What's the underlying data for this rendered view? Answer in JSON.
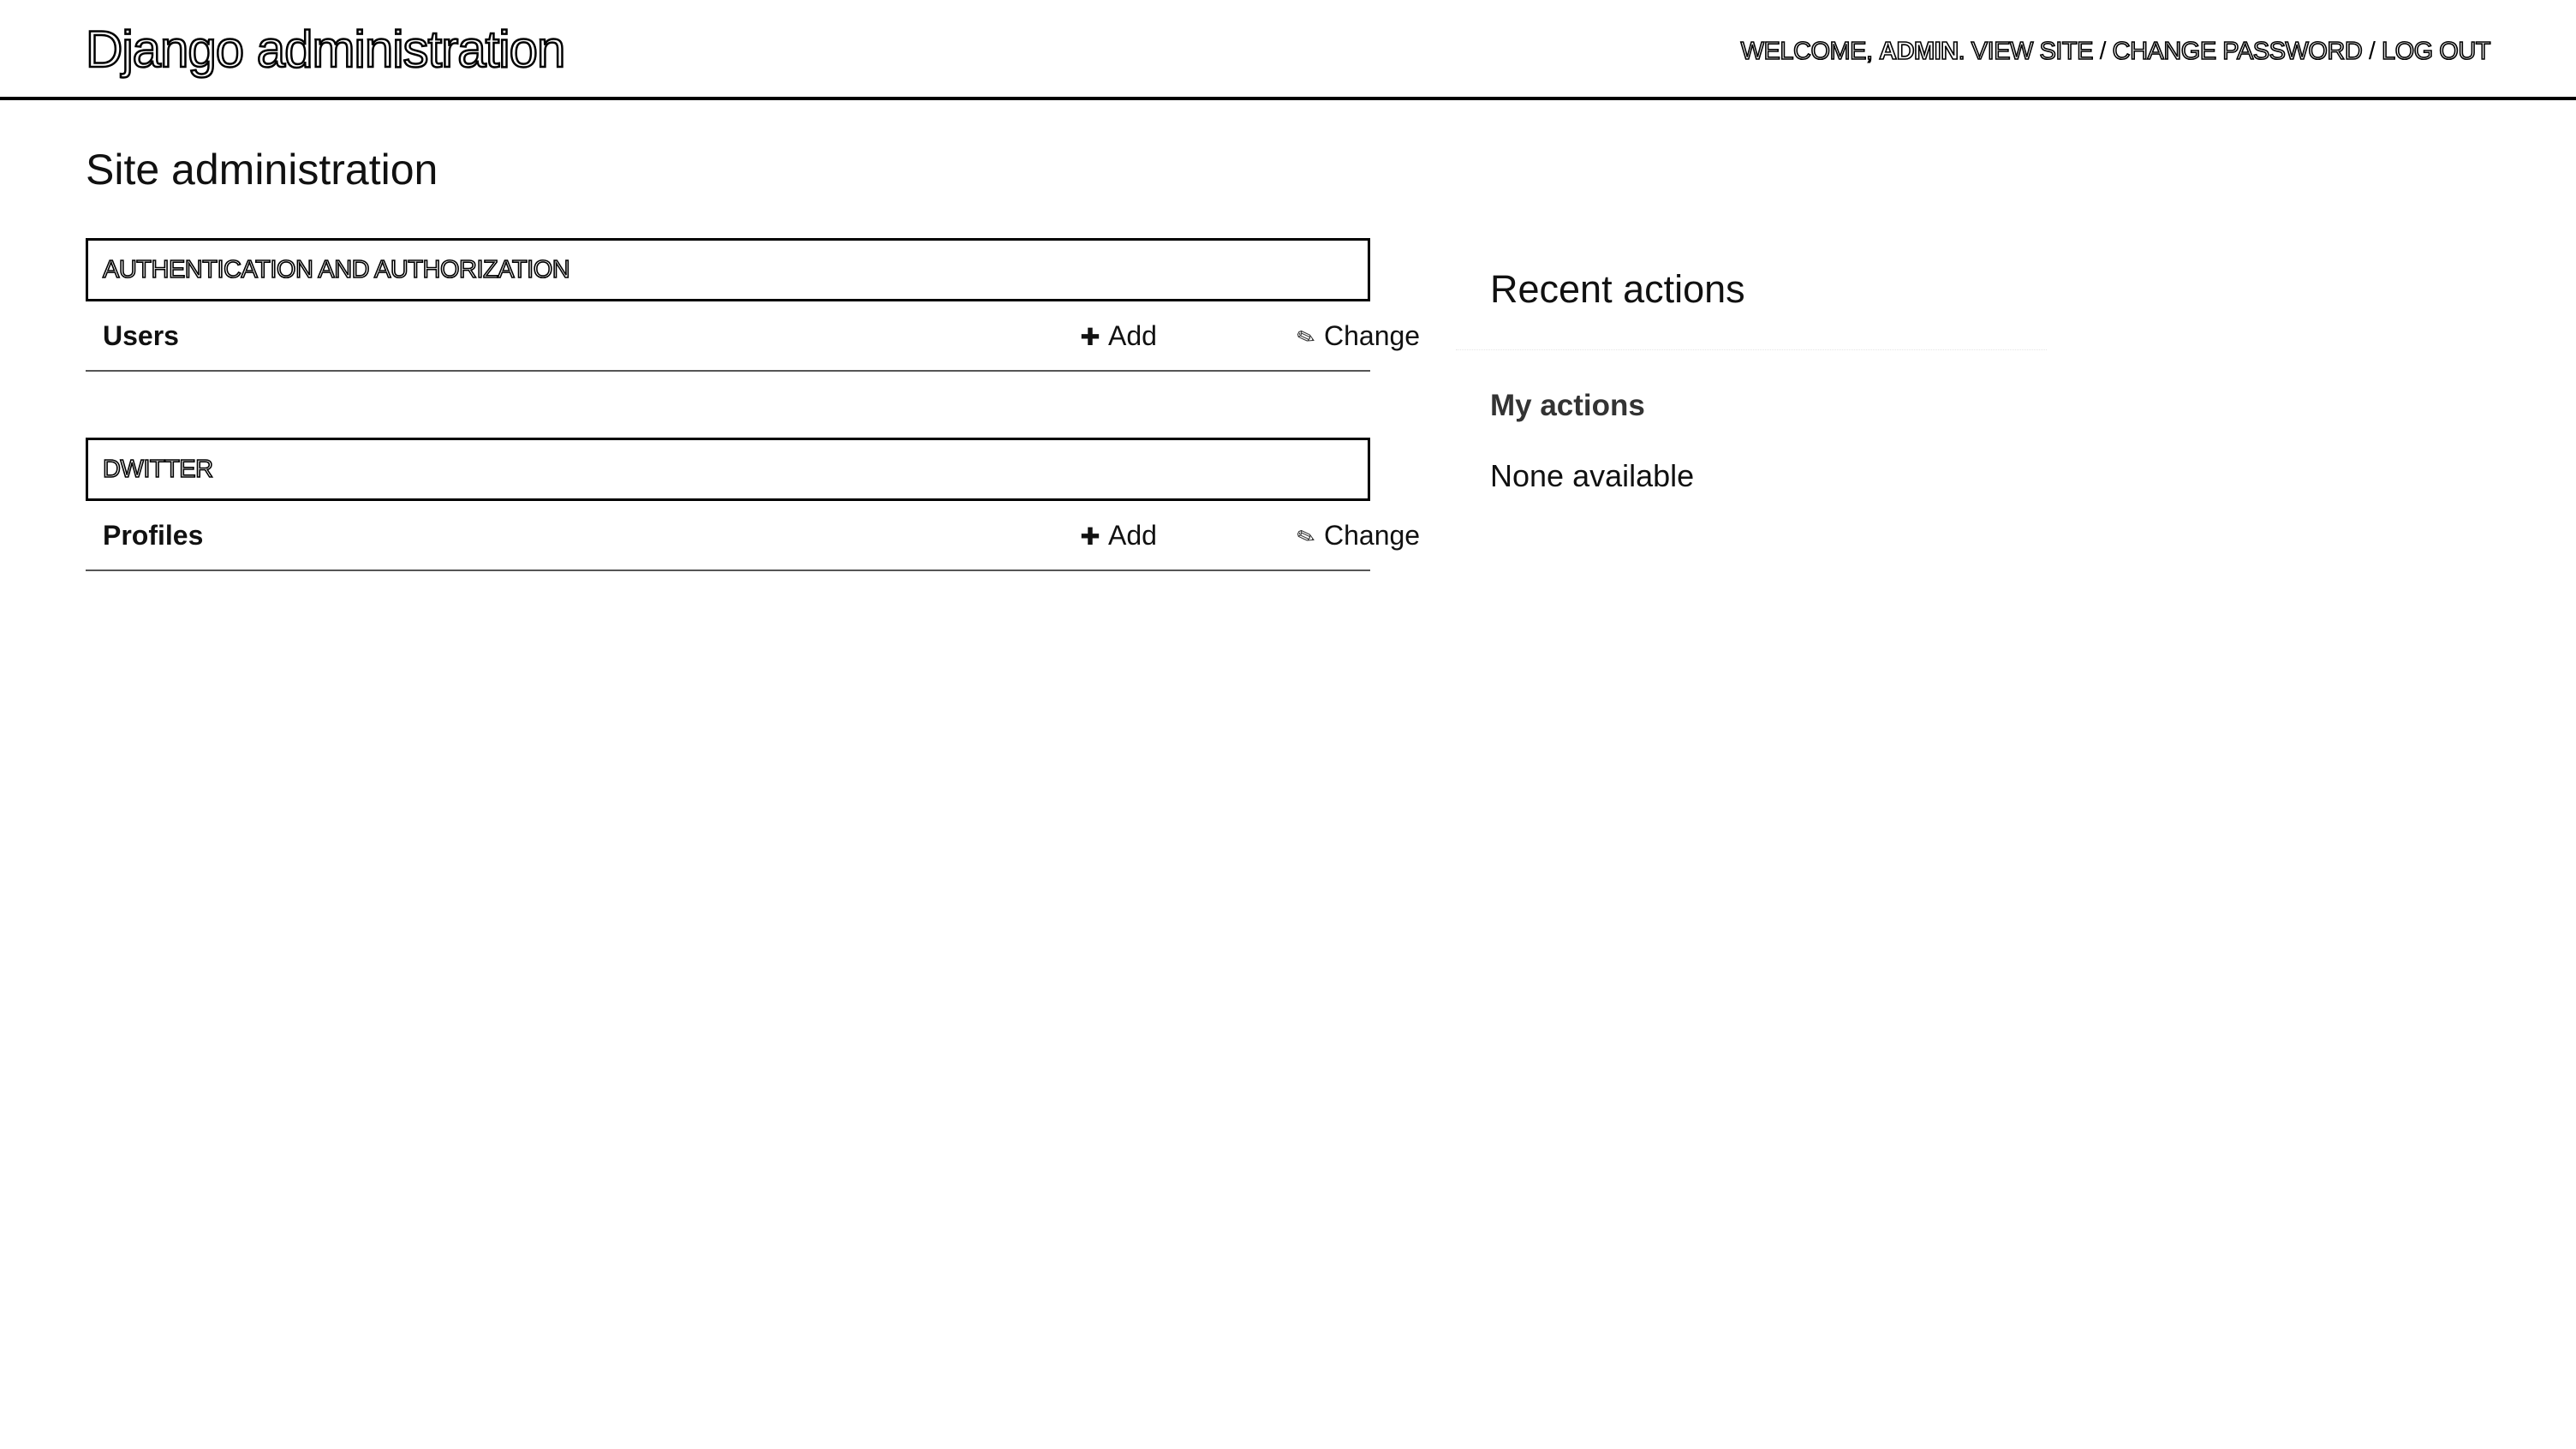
{
  "header": {
    "branding": "Django administration",
    "welcome_prefix": "Welcome,",
    "user_name": "admin",
    "welcome_suffix": ".",
    "view_site": "View site",
    "change_password": "Change password",
    "log_out": "Log out",
    "separator": "/"
  },
  "content": {
    "title": "Site administration"
  },
  "modules": [
    {
      "caption": "Authentication and Authorization",
      "rows": [
        {
          "name": "Users",
          "add_label": "Add",
          "change_label": "Change"
        }
      ]
    },
    {
      "caption": "Dwitter",
      "rows": [
        {
          "name": "Profiles",
          "add_label": "Add",
          "change_label": "Change"
        }
      ]
    }
  ],
  "icons": {
    "add": "add-icon",
    "change": "change-icon"
  },
  "sidebar": {
    "recent_actions_title": "Recent actions",
    "my_actions_title": "My actions",
    "none_available": "None available"
  }
}
